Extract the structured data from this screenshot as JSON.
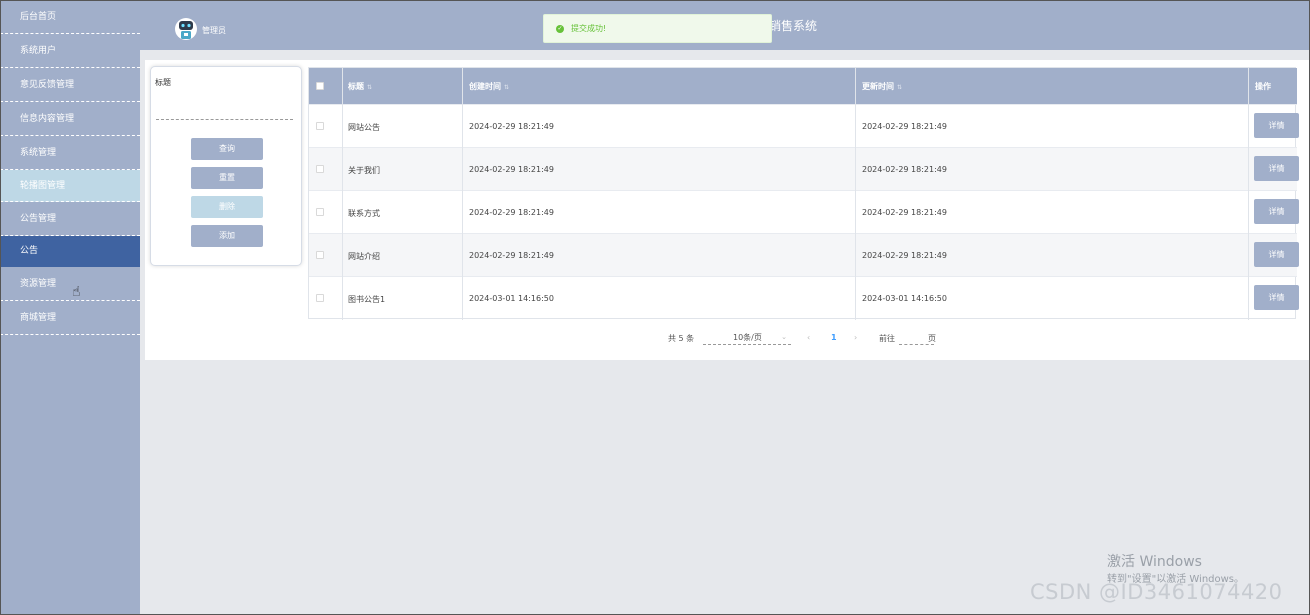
{
  "sidebar": {
    "items": [
      {
        "label": "后台首页"
      },
      {
        "label": "系统用户"
      },
      {
        "label": "意见反馈管理"
      },
      {
        "label": "信息内容管理"
      },
      {
        "label": "系统管理"
      },
      {
        "label": "轮播图管理"
      },
      {
        "label": "公告管理"
      },
      {
        "label": "公告"
      },
      {
        "label": "资源管理"
      },
      {
        "label": "商城管理"
      }
    ]
  },
  "header": {
    "admin_label": "管理员",
    "system_title_visible": "销售系统"
  },
  "toast": {
    "message": "提交成功!"
  },
  "search": {
    "label": "标题",
    "input_value": "",
    "buttons": {
      "query": "查询",
      "reset": "重置",
      "delete": "删除",
      "add": "添加"
    }
  },
  "table": {
    "columns": {
      "title": "标题",
      "created": "创建时间",
      "updated": "更新时间",
      "action": "操作"
    },
    "rows": [
      {
        "title": "网站公告",
        "created": "2024-02-29 18:21:49",
        "updated": "2024-02-29 18:21:49",
        "action": "详情"
      },
      {
        "title": "关于我们",
        "created": "2024-02-29 18:21:49",
        "updated": "2024-02-29 18:21:49",
        "action": "详情"
      },
      {
        "title": "联系方式",
        "created": "2024-02-29 18:21:49",
        "updated": "2024-02-29 18:21:49",
        "action": "详情"
      },
      {
        "title": "网站介绍",
        "created": "2024-02-29 18:21:49",
        "updated": "2024-02-29 18:21:49",
        "action": "详情"
      },
      {
        "title": "图书公告1",
        "created": "2024-03-01 14:16:50",
        "updated": "2024-03-01 14:16:50",
        "action": "详情"
      }
    ]
  },
  "pagination": {
    "total": "共 5 条",
    "page_size": "10条/页",
    "prev": "‹",
    "current_page": "1",
    "next": "›",
    "goto_label": "前往",
    "goto_unit": "页"
  },
  "watermark": {
    "activate_title": "激活 Windows",
    "activate_sub": "转到\"设置\"以激活 Windows。",
    "csdn": "CSDN @ID3461074420"
  },
  "colors": {
    "sidebar_bg": "#a1afca",
    "active_item": "#3f63a1",
    "light_item": "#bed8e6",
    "toast_text": "#67c23a"
  }
}
